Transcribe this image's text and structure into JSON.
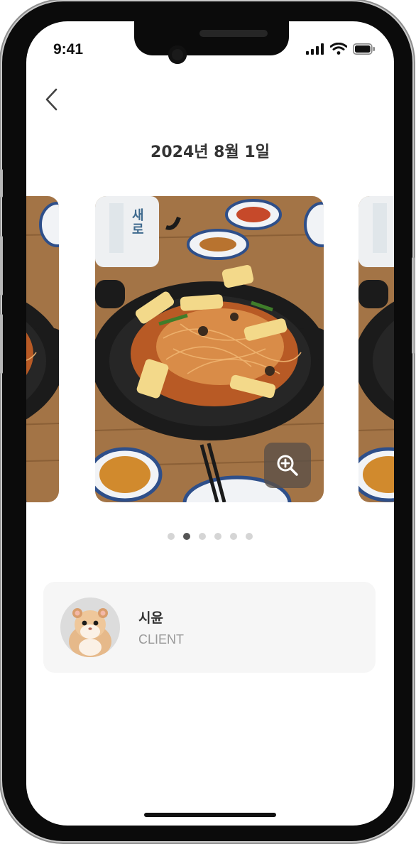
{
  "status": {
    "time": "9:41",
    "icons": [
      "signal-icon",
      "wifi-icon",
      "battery-icon"
    ]
  },
  "header": {
    "back_icon": "chevron-left-icon",
    "title": "2024년 8월 1일"
  },
  "gallery": {
    "slide_count": 6,
    "active_index": 1,
    "zoom_icon": "zoom-in-icon",
    "bottle_text": "새로"
  },
  "profile": {
    "name": "시윤",
    "role": "CLIENT"
  },
  "colors": {
    "active_dot": "#555555",
    "inactive_dot": "#d5d5d5",
    "card_bg": "#f6f6f6",
    "zoom_bg": "#5a5048"
  }
}
